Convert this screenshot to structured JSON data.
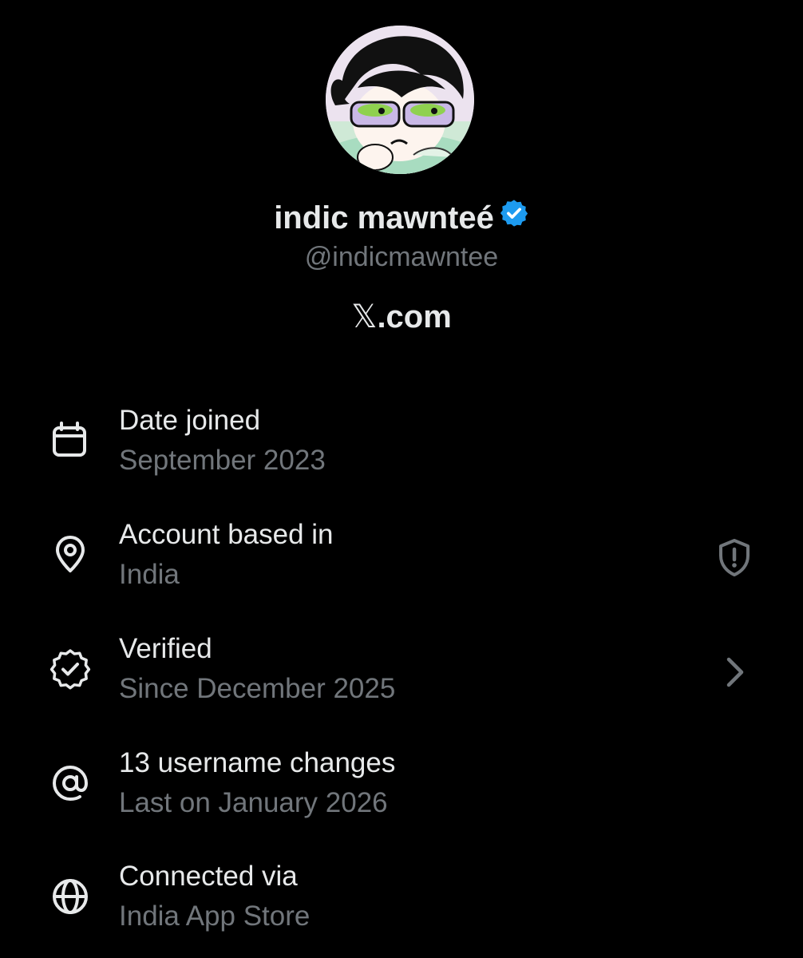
{
  "profile": {
    "display_name": "indic mawnteé",
    "handle": "@indicmawntee",
    "site_x": "𝕏",
    "site_rest": ".com",
    "badge_color": "#1d9bf0"
  },
  "rows": [
    {
      "label": "Date joined",
      "value": "September 2023",
      "icon": "calendar-icon"
    },
    {
      "label": "Account based in",
      "value": "India",
      "icon": "location-pin-icon",
      "right_icon": "shield-alert-icon"
    },
    {
      "label": "Verified",
      "value": "Since December 2025",
      "icon": "verified-badge-icon",
      "right_icon": "chevron-right-icon"
    },
    {
      "label": "13 username changes",
      "value": "Last on January 2026",
      "icon": "at-sign-icon"
    },
    {
      "label": "Connected via",
      "value": "India App Store",
      "icon": "globe-icon"
    }
  ],
  "colors": {
    "background": "#000000",
    "primary_text": "#e7e9ea",
    "secondary_text": "#71767b"
  }
}
